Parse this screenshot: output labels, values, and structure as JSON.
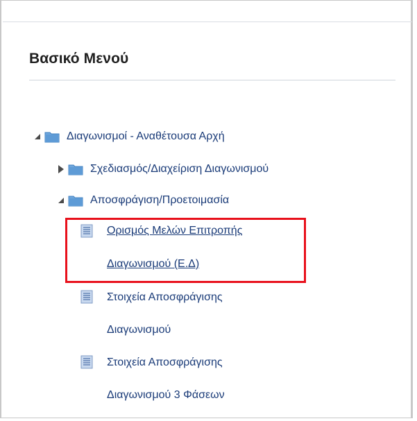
{
  "menu": {
    "title": "Βασικό Μενού"
  },
  "tree": {
    "root": {
      "label": "Διαγωνισμοί - Αναθέτουσα Αρχή",
      "expanded": true
    },
    "child1": {
      "label": "Σχεδιασμός/Διαχείριση Διαγωνισμού",
      "expanded": false
    },
    "child2": {
      "label": "Αποσφράγιση/Προετοιμασία",
      "expanded": true
    },
    "leaves": [
      {
        "line1": "Ορισμός Μελών Επιτροπής",
        "line2": "Διαγωνισμού (Ε.Δ)",
        "selected": true
      },
      {
        "line1": "Στοιχεία Αποσφράγισης",
        "line2": "Διαγωνισμού",
        "selected": false
      },
      {
        "line1": "Στοιχεία Αποσφράγισης",
        "line2": "Διαγωνισμού 3 Φάσεων",
        "selected": false
      }
    ]
  },
  "colors": {
    "link": "#1a3b78",
    "highlight": "#e8101b",
    "folder": "#5e9bd6"
  },
  "icons": {
    "expanded": "triangle-down-right-icon",
    "collapsed": "triangle-right-icon",
    "folder": "folder-icon",
    "page": "page-icon"
  }
}
